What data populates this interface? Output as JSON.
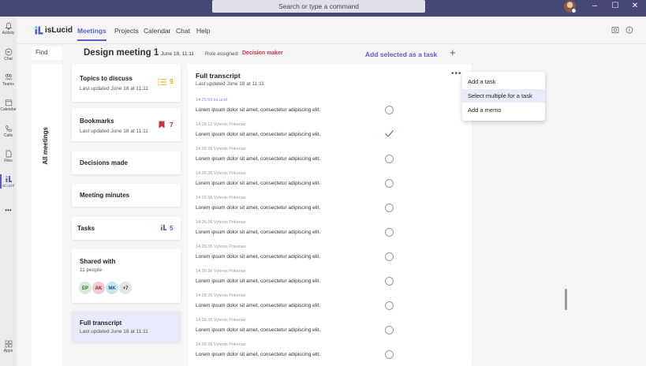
{
  "titlebar": {
    "search_placeholder": "Search or type a command",
    "minimize": "–",
    "maximize": "☐",
    "close": "✕"
  },
  "rail": {
    "items": [
      {
        "label": "Activity",
        "icon": "bell-icon"
      },
      {
        "label": "Chat",
        "icon": "chat-icon"
      },
      {
        "label": "Teams",
        "icon": "teams-icon"
      },
      {
        "label": "Calendar",
        "icon": "calendar-icon"
      },
      {
        "label": "Calls",
        "icon": "phone-icon"
      },
      {
        "label": "Files",
        "icon": "file-icon"
      },
      {
        "label": "isLucid",
        "icon": "islucid-icon"
      }
    ],
    "more": "•••",
    "apps": "Apps"
  },
  "appbar": {
    "app_name": "isLucid",
    "tabs": [
      {
        "label": "Meetings",
        "active": true
      },
      {
        "label": "Projects"
      },
      {
        "label": "Calendar"
      },
      {
        "label": "Chat"
      },
      {
        "label": "Help"
      }
    ]
  },
  "subheader": {
    "find": "Find",
    "meeting_title": "Design meeting 1",
    "meeting_date": "June 18, 11:11",
    "role_label": "Role assigned:",
    "role_value": "Decision maker",
    "add_selected": "Add selected as a task",
    "plus": "+"
  },
  "sidebar": {
    "all_meetings": "All meetings"
  },
  "cards": {
    "topics": {
      "title": "Topics to discuss",
      "sub": "Last updated June 18 at 11:11",
      "count": "9"
    },
    "bookmarks": {
      "title": "Bookmarks",
      "sub": "Last updated June 18 at 11:11",
      "count": "7"
    },
    "decisions": {
      "title": "Decisions made"
    },
    "minutes": {
      "title": "Meeting minutes"
    },
    "tasks": {
      "title": "Tasks",
      "count": "5"
    },
    "shared": {
      "title": "Shared with",
      "sub": "11 people",
      "avatars": [
        "EP",
        "AK",
        "MK",
        "+7"
      ]
    },
    "transcript": {
      "title": "Full transcript",
      "sub": "Last updated June 18 at 11:11"
    }
  },
  "transcript": {
    "title": "Full transcript",
    "sub": "Last updated June 18 at 11:11",
    "more": "•••",
    "entries": [
      {
        "meta": "14:25:56 isLucid",
        "text": "Lorem ipsum dolor sit amet, consectetur adipiscing elit.",
        "checked": false
      },
      {
        "meta": "14:26:12 Vytenis Pokenas",
        "text": "Lorem ipsum dolor sit amet, consectetur adipiscing elit.",
        "checked": true
      },
      {
        "meta": "14:26:36 Vytenis Pokenas",
        "text": "Lorem ipsum dolor sit amet, consectetur adipiscing elit.",
        "checked": false
      },
      {
        "meta": "14:26:36 Vytenis Pokenas",
        "text": "Lorem ipsum dolor sit amet, consectetur adipiscing elit.",
        "checked": false
      },
      {
        "meta": "14:26:36 Vytenis Pokenas",
        "text": "Lorem ipsum dolor sit amet, consectetur adipiscing elit.",
        "checked": false
      },
      {
        "meta": "14:26:36 Vytenis Pokenas",
        "text": "Lorem ipsum dolor sit amet, consectetur adipiscing elit.",
        "checked": false
      },
      {
        "meta": "14:26:36 Vytenis Pokenas",
        "text": "Lorem ipsum dolor sit amet, consectetur adipiscing elit.",
        "checked": false
      },
      {
        "meta": "14:26:36 Vytenis Pokenas",
        "text": "Lorem ipsum dolor sit amet, consectetur adipiscing elit.",
        "checked": false
      },
      {
        "meta": "14:26:36 Vytenis Pokenas",
        "text": "Lorem ipsum dolor sit amet, consectetur adipiscing elit.",
        "checked": false
      },
      {
        "meta": "14:26:36 Vytenis Pokenas",
        "text": "Lorem ipsum dolor sit amet, consectetur adipiscing elit.",
        "checked": false
      },
      {
        "meta": "14:26:36 Vytenis Pokenas",
        "text": "Lorem ipsum dolor sit amet, consectetur adipiscing elit.",
        "checked": false
      }
    ]
  },
  "menu": {
    "items": [
      {
        "label": "Add a task"
      },
      {
        "label": "Select multiple for a task",
        "highlighted": true
      },
      {
        "label": "Add a memo"
      }
    ]
  },
  "colors": {
    "accent": "#5b5fc7",
    "titlebar": "#464775",
    "role": "#c4314b",
    "topics_icon": "#f2b200",
    "bookmark_icon": "#c4314b"
  }
}
